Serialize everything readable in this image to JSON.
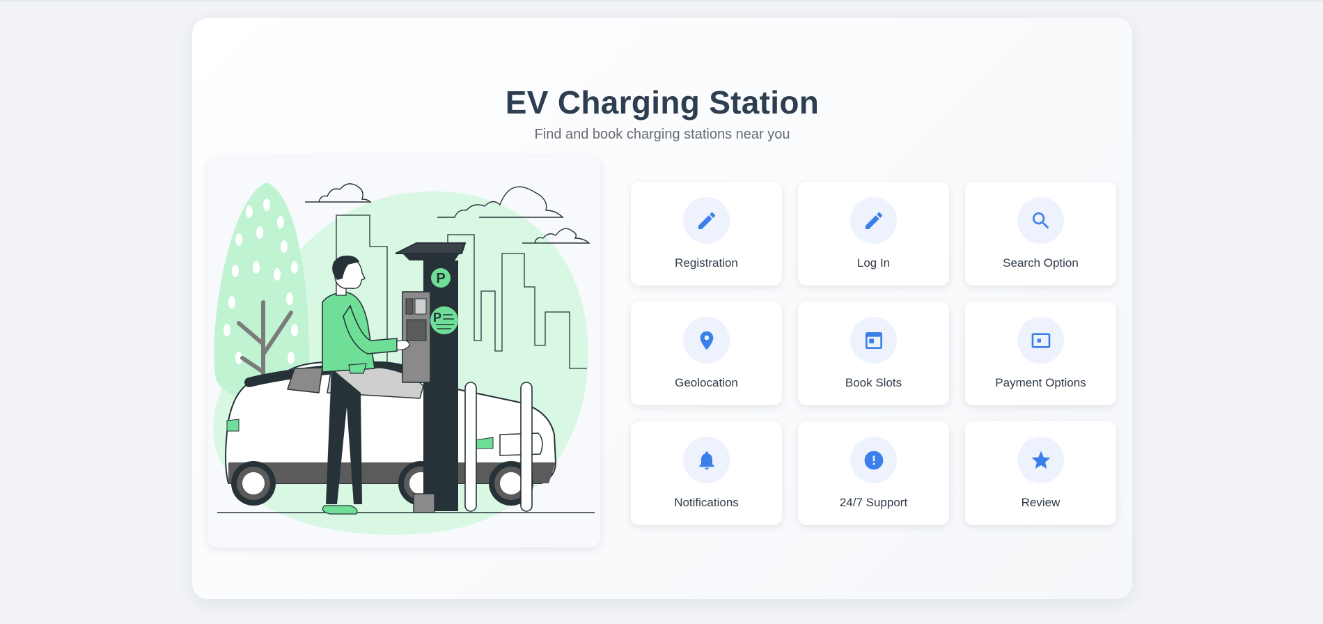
{
  "page": {
    "title": "EV Charging Station",
    "subtitle": "Find and book charging stations near you"
  },
  "colors": {
    "accent": "#3b7fea",
    "title": "#2c3e50",
    "illustration_green": "#6fdf97",
    "illustration_light_green": "#d9f8e3",
    "illustration_dark": "#263238"
  },
  "features": [
    {
      "label": "Registration",
      "icon": "pencil-icon"
    },
    {
      "label": "Log In",
      "icon": "pencil-icon"
    },
    {
      "label": "Search Option",
      "icon": "search-icon"
    },
    {
      "label": "Geolocation",
      "icon": "location-pin-icon"
    },
    {
      "label": "Book Slots",
      "icon": "calendar-icon"
    },
    {
      "label": "Payment Options",
      "icon": "card-icon"
    },
    {
      "label": "Notifications",
      "icon": "bell-icon"
    },
    {
      "label": "24/7 Support",
      "icon": "alert-icon"
    },
    {
      "label": "Review",
      "icon": "star-icon"
    }
  ],
  "illustration": {
    "parking_letter": "P"
  }
}
